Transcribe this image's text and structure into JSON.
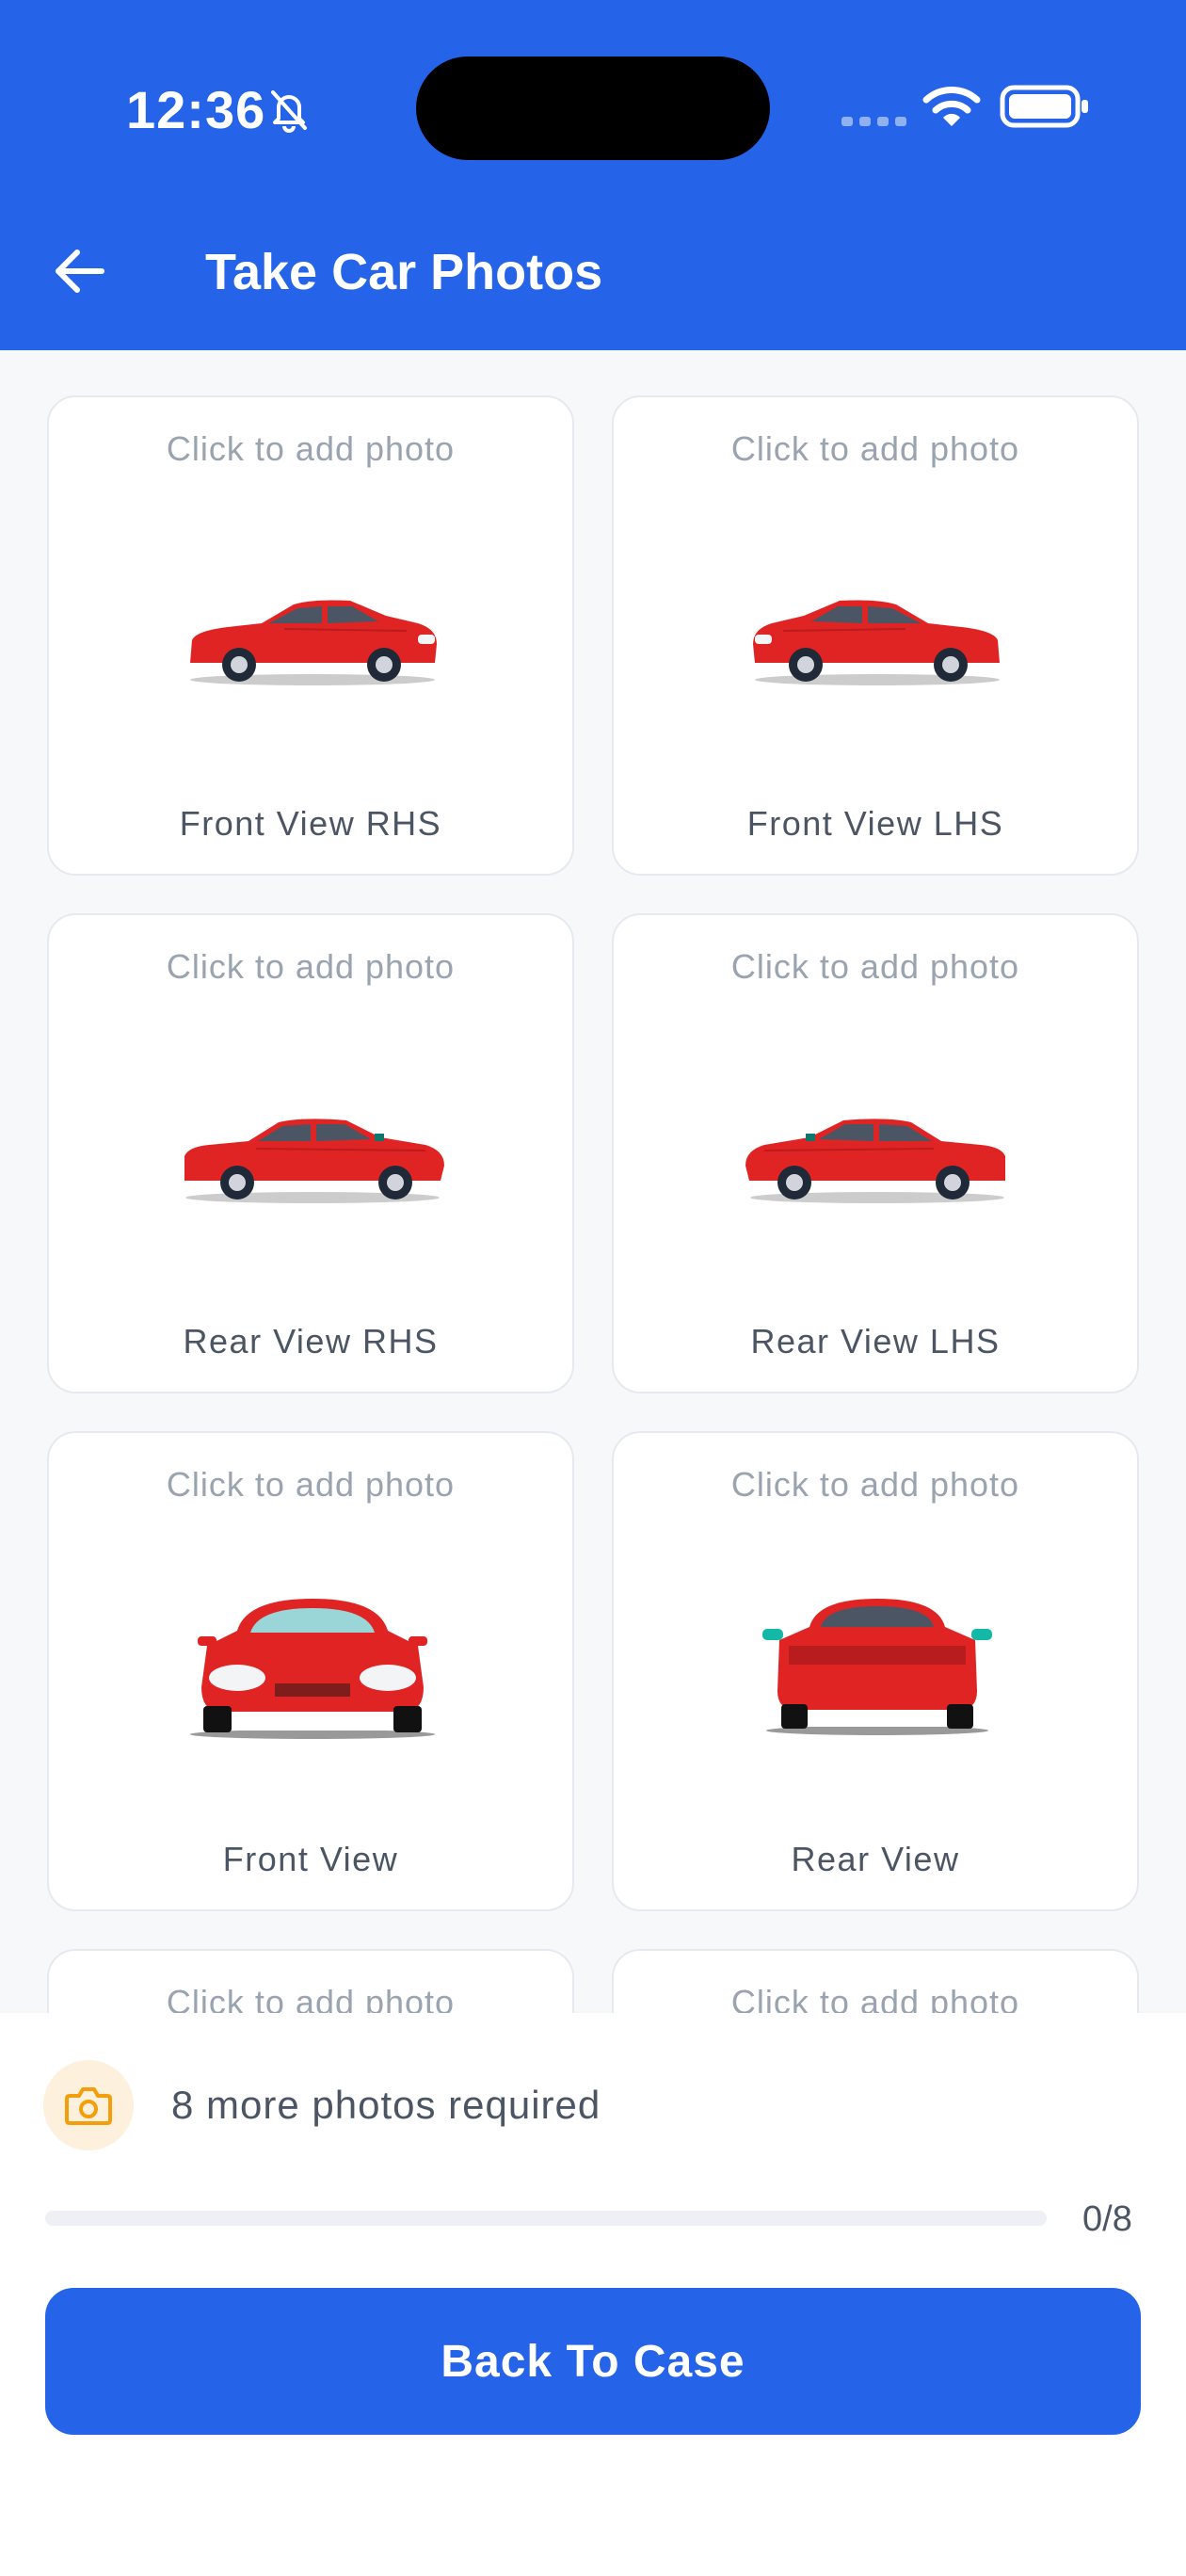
{
  "status_bar": {
    "time": "12:36"
  },
  "header": {
    "title": "Take Car Photos"
  },
  "cards": [
    {
      "hint": "Click to add photo",
      "label": "Front View RHS",
      "view": "side-front-right"
    },
    {
      "hint": "Click to add photo",
      "label": "Front View LHS",
      "view": "side-front-left"
    },
    {
      "hint": "Click to add photo",
      "label": "Rear View RHS",
      "view": "side-rear-right"
    },
    {
      "hint": "Click to add photo",
      "label": "Rear View LHS",
      "view": "side-rear-left"
    },
    {
      "hint": "Click to add photo",
      "label": "Front View",
      "view": "front"
    },
    {
      "hint": "Click to add photo",
      "label": "Rear View",
      "view": "rear"
    },
    {
      "hint": "Click to add photo",
      "label": "",
      "view": ""
    },
    {
      "hint": "Click to add photo",
      "label": "",
      "view": ""
    }
  ],
  "footer": {
    "required_text": "8 more photos required",
    "progress": {
      "completed": 0,
      "total": 8,
      "label": "0/8"
    },
    "button_label": "Back To Case"
  },
  "colors": {
    "primary": "#2563e8",
    "car_red": "#e02424",
    "badge_bg": "#fdf0dc",
    "camera_orange": "#f59e0b"
  }
}
